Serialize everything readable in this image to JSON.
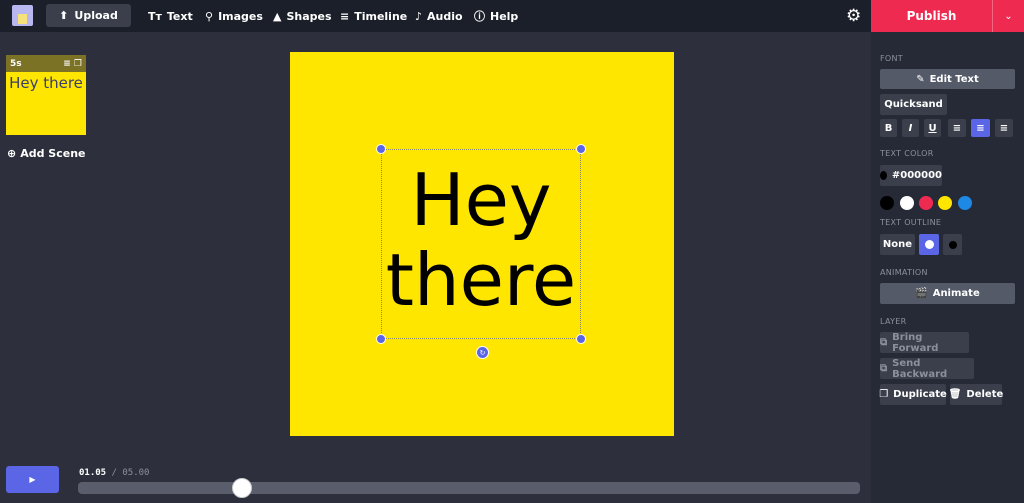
{
  "toolbar": {
    "upload": "Upload",
    "nav": [
      {
        "label": "Text",
        "icon": "Tт"
      },
      {
        "label": "Images",
        "icon": "⚲"
      },
      {
        "label": "Shapes",
        "icon": "▲"
      },
      {
        "label": "Timeline",
        "icon": "≡"
      },
      {
        "label": "Audio",
        "icon": "♪"
      },
      {
        "label": "Help",
        "icon": "?"
      }
    ],
    "publish": "Publish",
    "publish_color": "#ef2a51"
  },
  "scenes": {
    "items": [
      {
        "duration": "5s",
        "text": "Hey there"
      }
    ],
    "add_label": "Add Scene"
  },
  "canvas": {
    "text_line1": "Hey",
    "text_line2": "there",
    "background": "#ffe600"
  },
  "panel": {
    "font_label": "FONT",
    "edit_text": "Edit Text",
    "font_name": "Quicksand",
    "format": [
      "B",
      "I",
      "U"
    ],
    "text_color_label": "TEXT COLOR",
    "text_color_value": "#000000",
    "swatches": [
      "#000000",
      "#ffffff",
      "#ef2a51",
      "#ffe600",
      "#1e88e5"
    ],
    "outline_label": "TEXT OUTLINE",
    "outline_none": "None",
    "animation_label": "ANIMATION",
    "animate": "Animate",
    "layer_label": "LAYER",
    "bring_forward": "Bring Forward",
    "send_backward": "Send Backward",
    "duplicate": "Duplicate",
    "delete": "Delete"
  },
  "timeline": {
    "current": "01.05",
    "separator": " / ",
    "total": "05.00",
    "progress": 0.21
  }
}
